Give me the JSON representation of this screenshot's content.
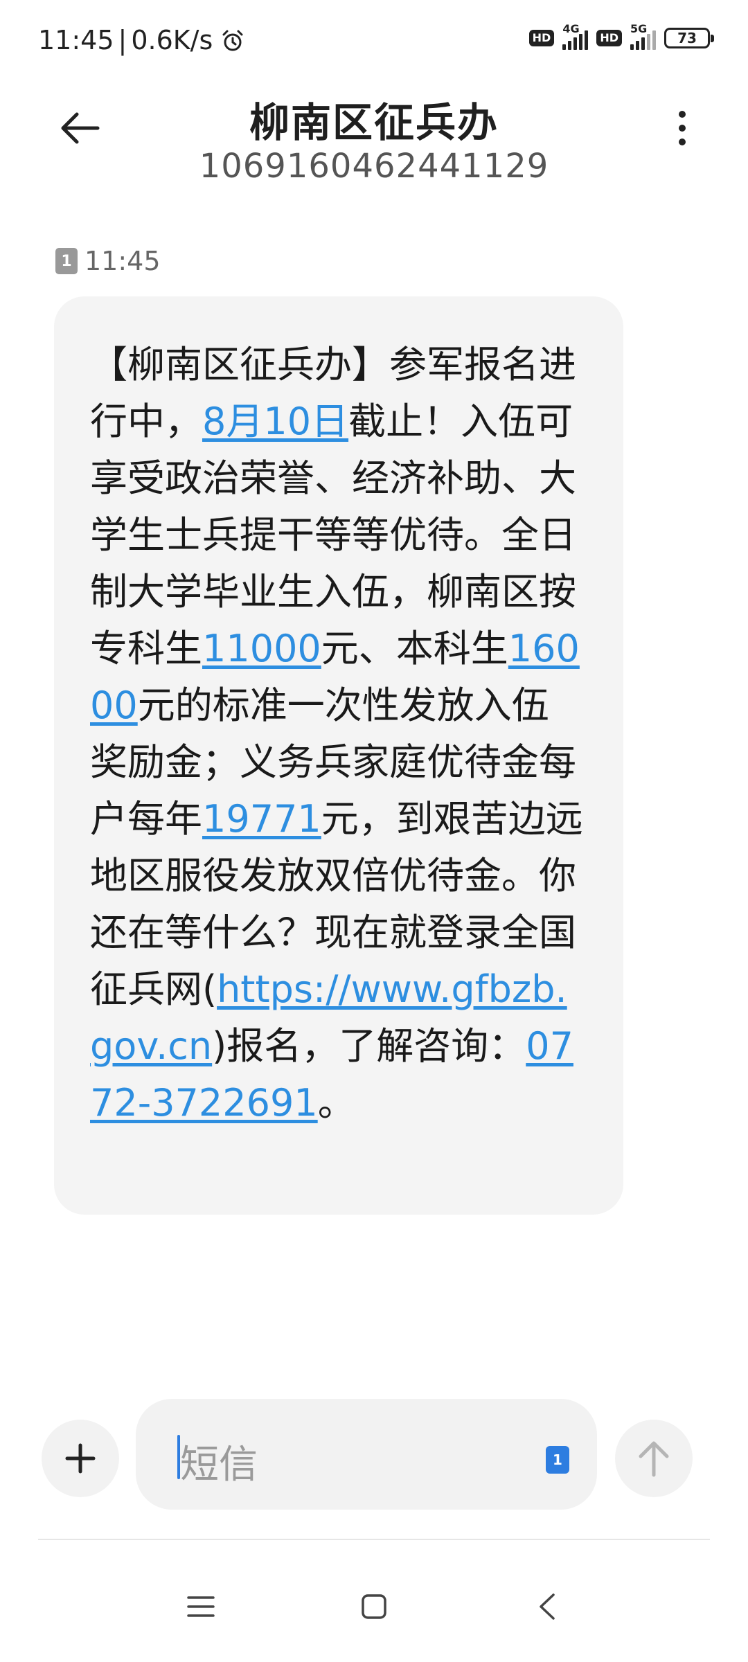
{
  "status_bar": {
    "time": "11:45",
    "separator": "|",
    "net_speed": "0.6K/s",
    "sim1_badge": "HD",
    "sim1_network": "4G",
    "sim2_badge": "HD",
    "sim2_network": "5G",
    "battery_level": "73",
    "icons": [
      "alarm-icon",
      "signal-icon",
      "battery-icon"
    ]
  },
  "header": {
    "contact_name": "柳南区征兵办",
    "contact_number": "1069160462441129",
    "icons": [
      "back-arrow-icon",
      "more-vert-icon"
    ]
  },
  "message": {
    "sim_slot": "1",
    "time": "11:45",
    "segments": [
      {
        "text": "【柳南区征兵办】参军报名进行中，",
        "link": false
      },
      {
        "text": "8月10日",
        "link": true
      },
      {
        "text": "截止！入伍可享受政治荣誉、经济补助、大学生士兵提干等等优待。全日制大学毕业生入伍，柳南区按专科生",
        "link": false
      },
      {
        "text": "11000",
        "link": true
      },
      {
        "text": "元、本科生",
        "link": false
      },
      {
        "text": "16000",
        "link": true
      },
      {
        "text": "元的标准一次性发放入伍奖励金；义务兵家庭优待金每户每年",
        "link": false
      },
      {
        "text": "19771",
        "link": true
      },
      {
        "text": "元，到艰苦边远地区服役发放双倍优待金。你还在等什么？现在就登录全国征兵网(",
        "link": false
      },
      {
        "text": "https://www.gfbzb.gov.cn",
        "link": true
      },
      {
        "text": ")报名，了解咨询：",
        "link": false
      },
      {
        "text": "0772-3722691",
        "link": true
      },
      {
        "text": "。",
        "link": false
      }
    ]
  },
  "composer": {
    "placeholder": "短信",
    "sim_selector": "1",
    "icons": [
      "plus-icon",
      "sim-card-icon",
      "send-arrow-icon"
    ]
  },
  "nav_bar": {
    "icons": [
      "menu-icon",
      "home-icon",
      "back-icon"
    ]
  },
  "colors": {
    "link": "#2d8ee0",
    "accent": "#2d7de0",
    "bubble": "#f4f4f4"
  }
}
